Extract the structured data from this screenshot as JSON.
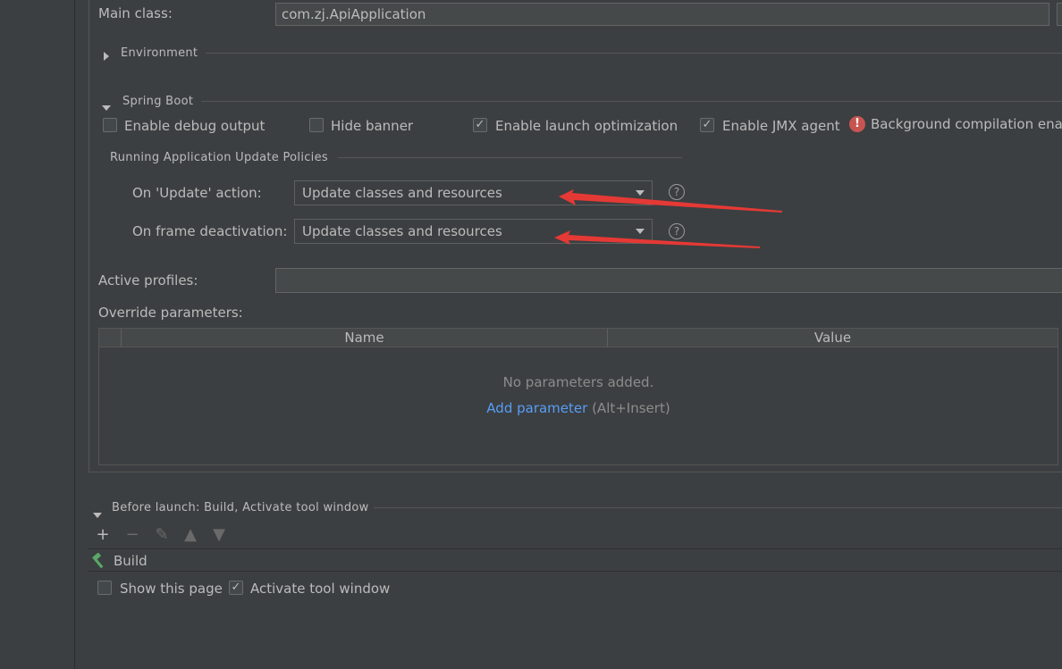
{
  "main_class": {
    "label": "Main class:",
    "value": "com.zj.ApiApplication"
  },
  "environment": {
    "label": "Environment"
  },
  "spring_boot": {
    "title": "Spring Boot",
    "checkboxes": [
      {
        "label": "Enable debug output",
        "checked": false
      },
      {
        "label": "Hide banner",
        "checked": false
      },
      {
        "label": "Enable launch optimization",
        "checked": true
      },
      {
        "label": "Enable JMX agent",
        "checked": true
      }
    ],
    "warning": "Background compilation enab",
    "policies_title": "Running Application Update Policies",
    "on_update": {
      "label": "On 'Update' action:",
      "value": "Update classes and resources"
    },
    "on_frame": {
      "label": "On frame deactivation:",
      "value": "Update classes and resources"
    }
  },
  "active_profiles": {
    "label": "Active profiles:",
    "value": ""
  },
  "override": {
    "label": "Override parameters:",
    "columns": [
      "Name",
      "Value"
    ],
    "empty_text": "No parameters added.",
    "add_link": "Add parameter",
    "add_shortcut": "(Alt+Insert)"
  },
  "before_launch": {
    "title": "Before launch: Build, Activate tool window",
    "items": [
      {
        "label": "Build",
        "icon": "hammer-icon"
      }
    ],
    "show_page": {
      "label": "Show this page",
      "checked": false
    },
    "activate_window": {
      "label": "Activate tool window",
      "checked": true
    }
  },
  "colors": {
    "background": "#3c3f41",
    "text": "#bbbbbb",
    "link": "#589df6",
    "annotation": "#e53935",
    "error": "#c75450"
  }
}
